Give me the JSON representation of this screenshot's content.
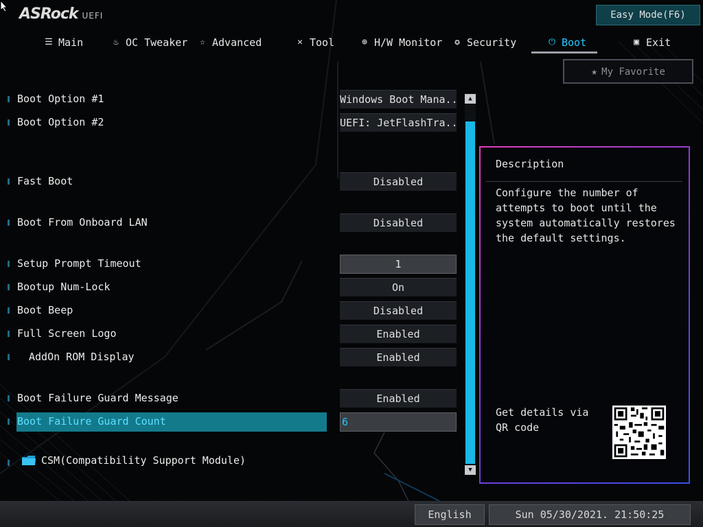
{
  "brand": {
    "logo": "ASRock",
    "sub": "UEFI"
  },
  "easy_mode": "Easy Mode(F6)",
  "tabs": [
    {
      "label": "Main",
      "icon": "list-icon"
    },
    {
      "label": "OC Tweaker",
      "icon": "rocket-icon"
    },
    {
      "label": "Advanced",
      "icon": "star-arrow-icon"
    },
    {
      "label": "Tool",
      "icon": "tools-icon"
    },
    {
      "label": "H/W Monitor",
      "icon": "crosshair-icon"
    },
    {
      "label": "Security",
      "icon": "shield-icon"
    },
    {
      "label": "Boot",
      "icon": "power-icon",
      "active": true
    },
    {
      "label": "Exit",
      "icon": "exit-door-icon"
    }
  ],
  "favorite": "My Favorite",
  "settings": {
    "boot_option_1": {
      "label": "Boot Option #1",
      "value": "Windows Boot Mana..."
    },
    "boot_option_2": {
      "label": "Boot Option #2",
      "value": "UEFI: JetFlashTra..."
    },
    "fast_boot": {
      "label": "Fast Boot",
      "value": "Disabled"
    },
    "boot_lan": {
      "label": "Boot From Onboard LAN",
      "value": "Disabled"
    },
    "setup_prompt": {
      "label": "Setup Prompt Timeout",
      "value": "1"
    },
    "numlock": {
      "label": "Bootup Num-Lock",
      "value": "On"
    },
    "boot_beep": {
      "label": "Boot Beep",
      "value": "Disabled"
    },
    "fullscreen_logo": {
      "label": "Full Screen Logo",
      "value": "Enabled"
    },
    "addon_rom": {
      "label": "AddOn ROM Display",
      "value": "Enabled"
    },
    "guard_message": {
      "label": "Boot Failure Guard Message",
      "value": "Enabled"
    },
    "guard_count": {
      "label": "Boot Failure Guard Count",
      "value": "6"
    },
    "csm": {
      "label": "CSM(Compatibility Support Module)"
    }
  },
  "description": {
    "title": "Description",
    "text": "Configure the number of attempts to boot until the system automatically restores the default settings.",
    "qr_text": "Get details via QR code"
  },
  "status": {
    "language": "English",
    "datetime": "Sun 05/30/2021. 21:50:25"
  },
  "colors": {
    "accent": "#22c9ff",
    "selection": "#137a8c",
    "scroll": "#1ab8e6"
  }
}
